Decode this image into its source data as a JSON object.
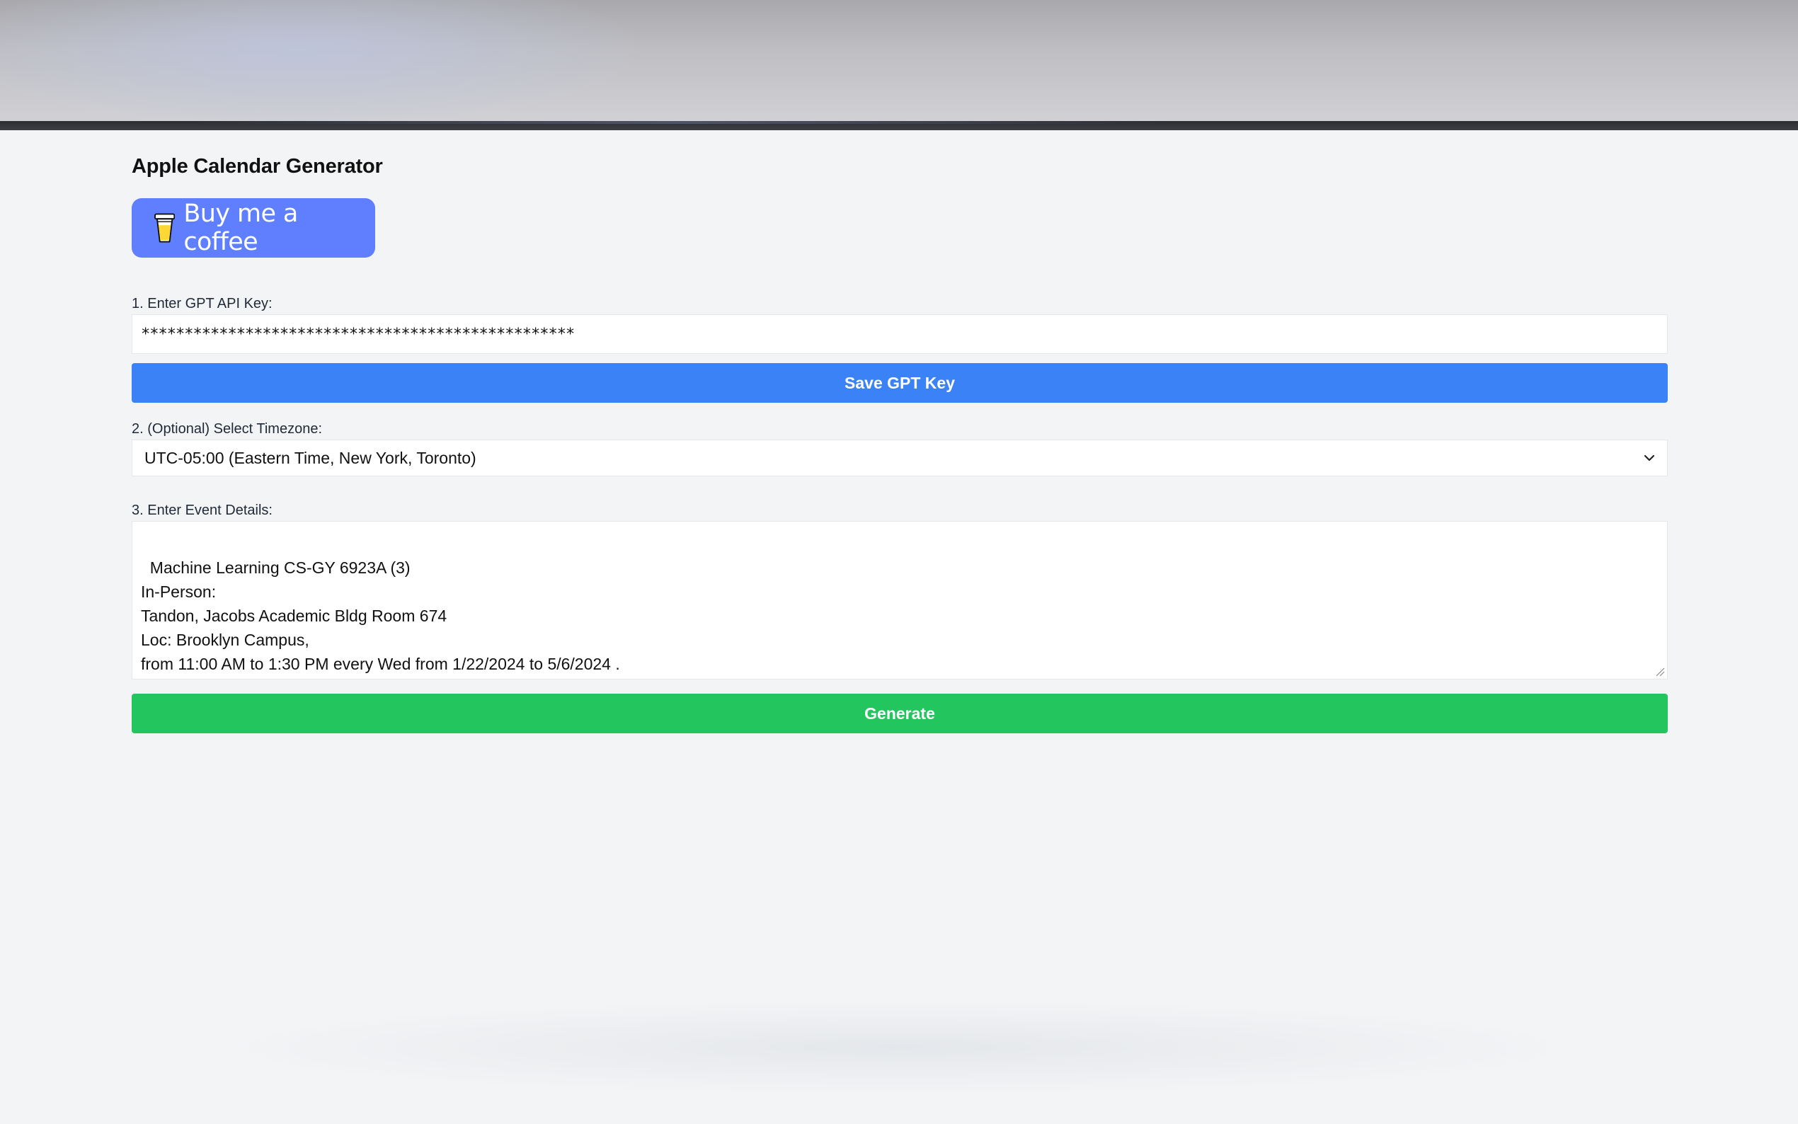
{
  "app": {
    "title": "Apple Calendar Generator"
  },
  "coffee": {
    "label": "Buy me a coffee",
    "icon": "coffee-cup-icon"
  },
  "api_key": {
    "label": "1. Enter GPT API Key:",
    "value": "**************************************************",
    "save_label": "Save GPT Key"
  },
  "timezone": {
    "label": "2. (Optional) Select Timezone:",
    "selected": "UTC-05:00 (Eastern Time, New York, Toronto)",
    "icon": "chevron-down-icon"
  },
  "event": {
    "label": "3. Enter Event Details:",
    "text": "Machine Learning CS-GY 6923A (3)\nIn-Person:\nTandon, Jacobs Academic Bldg Room 674\nLoc: Brooklyn Campus,\nfrom 11:00 AM to 1:30 PM every Wed from 1/22/2024 to 5/6/2024 ."
  },
  "generate": {
    "label": "Generate"
  },
  "colors": {
    "page_background": "#f3f4f6",
    "coffee_button": "#5f7fff",
    "save_button": "#3b82f6",
    "generate_button": "#22c55e"
  }
}
